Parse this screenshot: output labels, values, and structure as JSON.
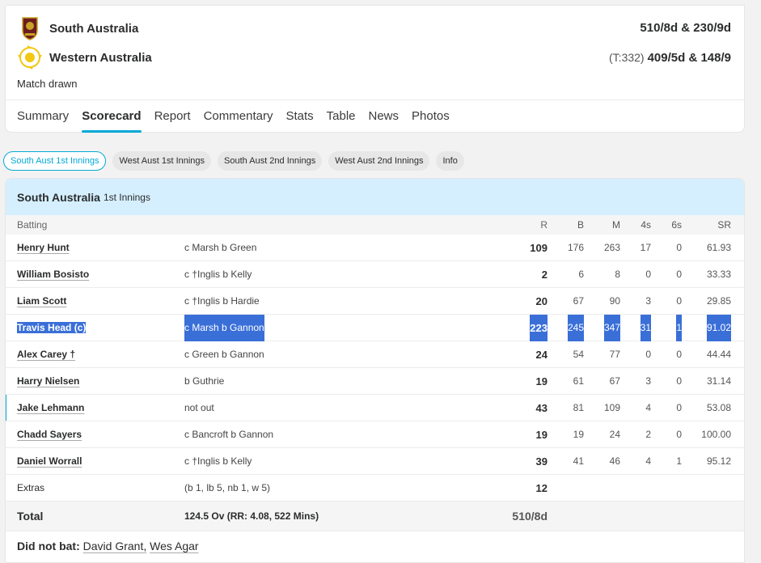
{
  "match": {
    "team1": {
      "name": "South Australia",
      "score": "510/8d & 230/9d"
    },
    "team2": {
      "name": "Western Australia",
      "target": "(T:332)",
      "score": "409/5d & 148/9"
    },
    "result": "Match drawn"
  },
  "tabs": [
    "Summary",
    "Scorecard",
    "Report",
    "Commentary",
    "Stats",
    "Table",
    "News",
    "Photos"
  ],
  "active_tab": "Scorecard",
  "innings_pills": [
    "South Aust 1st Innings",
    "West Aust 1st Innings",
    "South Aust 2nd Innings",
    "West Aust 2nd Innings",
    "Info"
  ],
  "panel": {
    "team": "South Australia",
    "innings": "1st Innings"
  },
  "headers": {
    "batting": "Batting",
    "r": "R",
    "b": "B",
    "m": "M",
    "fours": "4s",
    "sixes": "6s",
    "sr": "SR"
  },
  "batters": [
    {
      "name": "Henry Hunt",
      "dismissal": "c Marsh b Green",
      "r": "109",
      "b": "176",
      "m": "263",
      "fours": "17",
      "sixes": "0",
      "sr": "61.93"
    },
    {
      "name": "William Bosisto",
      "dismissal": "c †Inglis b Kelly",
      "r": "2",
      "b": "6",
      "m": "8",
      "fours": "0",
      "sixes": "0",
      "sr": "33.33"
    },
    {
      "name": "Liam Scott",
      "dismissal": "c †Inglis b Hardie",
      "r": "20",
      "b": "67",
      "m": "90",
      "fours": "3",
      "sixes": "0",
      "sr": "29.85"
    },
    {
      "name": "Travis Head (c)",
      "dismissal": "c Marsh b Gannon",
      "r": "223",
      "b": "245",
      "m": "347",
      "fours": "31",
      "sixes": "1",
      "sr": "91.02"
    },
    {
      "name": "Alex Carey †",
      "dismissal": "c Green b Gannon",
      "r": "24",
      "b": "54",
      "m": "77",
      "fours": "0",
      "sixes": "0",
      "sr": "44.44"
    },
    {
      "name": "Harry Nielsen",
      "dismissal": "b Guthrie",
      "r": "19",
      "b": "61",
      "m": "67",
      "fours": "3",
      "sixes": "0",
      "sr": "31.14"
    },
    {
      "name": "Jake Lehmann",
      "dismissal": "not out",
      "r": "43",
      "b": "81",
      "m": "109",
      "fours": "4",
      "sixes": "0",
      "sr": "53.08"
    },
    {
      "name": "Chadd Sayers",
      "dismissal": "c Bancroft b Gannon",
      "r": "19",
      "b": "19",
      "m": "24",
      "fours": "2",
      "sixes": "0",
      "sr": "100.00"
    },
    {
      "name": "Daniel Worrall",
      "dismissal": "c †Inglis b Kelly",
      "r": "39",
      "b": "41",
      "m": "46",
      "fours": "4",
      "sixes": "1",
      "sr": "95.12"
    }
  ],
  "extras": {
    "label": "Extras",
    "detail": "(b 1, lb 5, nb 1, w 5)",
    "value": "12"
  },
  "total": {
    "label": "Total",
    "overs": "124.5 Ov (RR: 4.08, 522 Mins)",
    "value": "510/8d"
  },
  "did_not_bat": {
    "label": "Did not bat:",
    "players": [
      "David Grant,",
      "Wes Agar"
    ]
  },
  "colors": {
    "accent": "#03a9d6",
    "panel_head": "#d5efff",
    "selection": "#3a6fd8"
  }
}
